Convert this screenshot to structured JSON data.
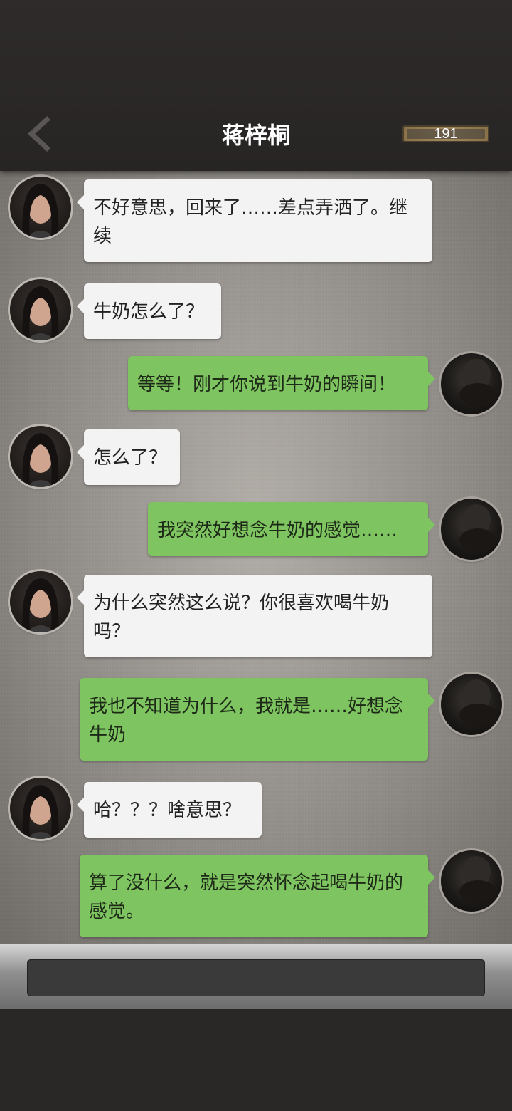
{
  "header": {
    "title": "蒋梓桐",
    "counter": "191",
    "back_icon": "chevron-left-icon"
  },
  "colors": {
    "header_bg": "#2a2727",
    "incoming_bubble": "#f3f3f3",
    "outgoing_bubble": "#7ec460",
    "counter_frame": "#a0875c"
  },
  "messages": [
    {
      "sender": "her",
      "text": "不好意思，回来了……差点弄洒了。继续"
    },
    {
      "sender": "her",
      "text": "牛奶怎么了？"
    },
    {
      "sender": "me",
      "text": "等等！刚才你说到牛奶的瞬间！"
    },
    {
      "sender": "her",
      "text": "怎么了？"
    },
    {
      "sender": "me",
      "text": "我突然好想念牛奶的感觉……"
    },
    {
      "sender": "her",
      "text": "为什么突然这么说？你很喜欢喝牛奶吗？"
    },
    {
      "sender": "me",
      "text": "我也不知道为什么，我就是……好想念牛奶"
    },
    {
      "sender": "her",
      "text": "哈？？？啥意思？"
    },
    {
      "sender": "me",
      "text": "算了没什么，就是突然怀念起喝牛奶的感觉。"
    }
  ],
  "input": {
    "value": ""
  }
}
